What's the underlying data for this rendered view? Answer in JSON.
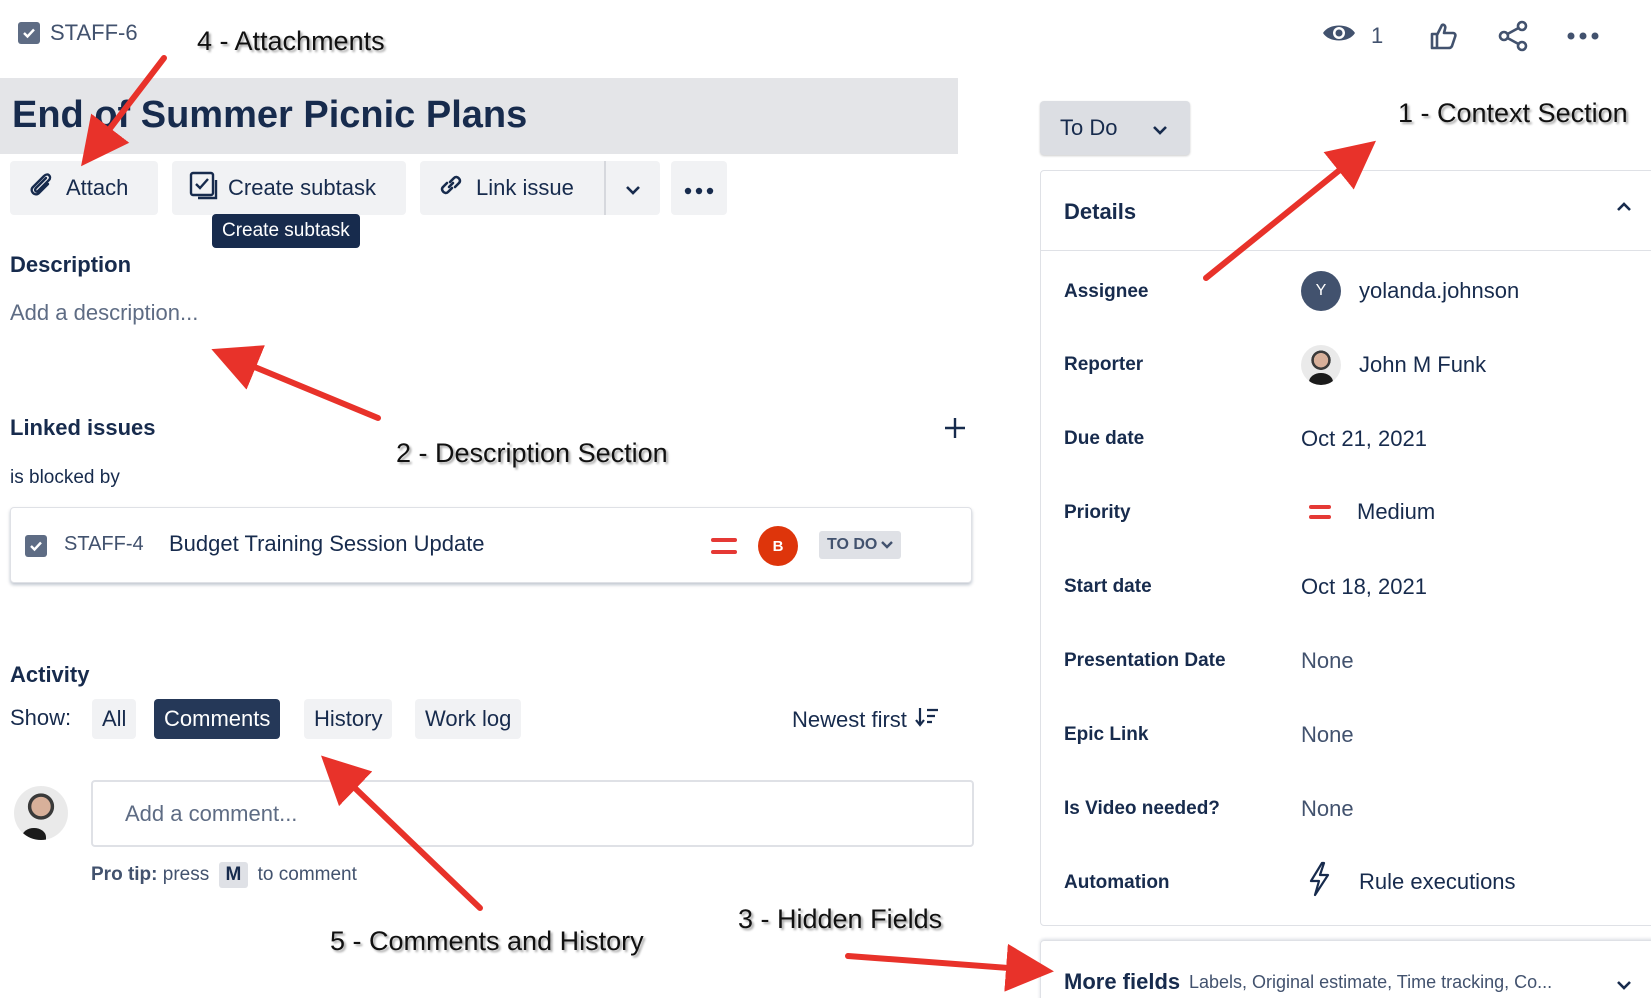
{
  "breadcrumb": {
    "issue_key": "STAFF-6"
  },
  "top_actions": {
    "watch_count": "1"
  },
  "issue": {
    "title": "End of Summer Picnic Plans"
  },
  "toolbar": {
    "attach_label": "Attach",
    "create_subtask_label": "Create subtask",
    "link_issue_label": "Link issue",
    "tooltip": "Create subtask"
  },
  "description": {
    "heading": "Description",
    "placeholder": "Add a description..."
  },
  "linked_issues": {
    "heading": "Linked issues",
    "relation": "is blocked by",
    "items": [
      {
        "key": "STAFF-4",
        "summary": "Budget Training Session Update",
        "priority": "Medium",
        "assignee_initial": "B",
        "status": "TO DO"
      }
    ]
  },
  "activity": {
    "heading": "Activity",
    "show_label": "Show:",
    "filters": [
      "All",
      "Comments",
      "History",
      "Work log"
    ],
    "active_filter": "Comments",
    "sort_label": "Newest first",
    "comment_placeholder": "Add a comment...",
    "pro_tip_prefix": "Pro tip:",
    "pro_tip_press": "press",
    "pro_tip_key": "M",
    "pro_tip_suffix": "to comment"
  },
  "status_button": {
    "label": "To Do"
  },
  "details": {
    "heading": "Details",
    "fields": [
      {
        "label": "Assignee",
        "value": "yolanda.johnson",
        "avatar_initial": "Y"
      },
      {
        "label": "Reporter",
        "value": "John M Funk"
      },
      {
        "label": "Due date",
        "value": "Oct 21, 2021"
      },
      {
        "label": "Priority",
        "value": "Medium"
      },
      {
        "label": "Start date",
        "value": "Oct 18, 2021"
      },
      {
        "label": "Presentation Date",
        "value": "None"
      },
      {
        "label": "Epic Link",
        "value": "None"
      },
      {
        "label": "Is Video needed?",
        "value": "None"
      },
      {
        "label": "Automation",
        "value": "Rule executions"
      }
    ]
  },
  "more_fields": {
    "label": "More fields",
    "summary": "Labels, Original estimate, Time tracking, Co..."
  },
  "annotations": {
    "a1": "1 - Context Section",
    "a2": "2 - Description Section",
    "a3": "3 - Hidden Fields",
    "a4": "4 - Attachments",
    "a5": "5 - Comments and History"
  },
  "colors": {
    "title_bar": "#e4e5e8",
    "active_chip": "#253858",
    "priority_medium": "#e53935",
    "annotation_arrow": "#e8322a"
  }
}
